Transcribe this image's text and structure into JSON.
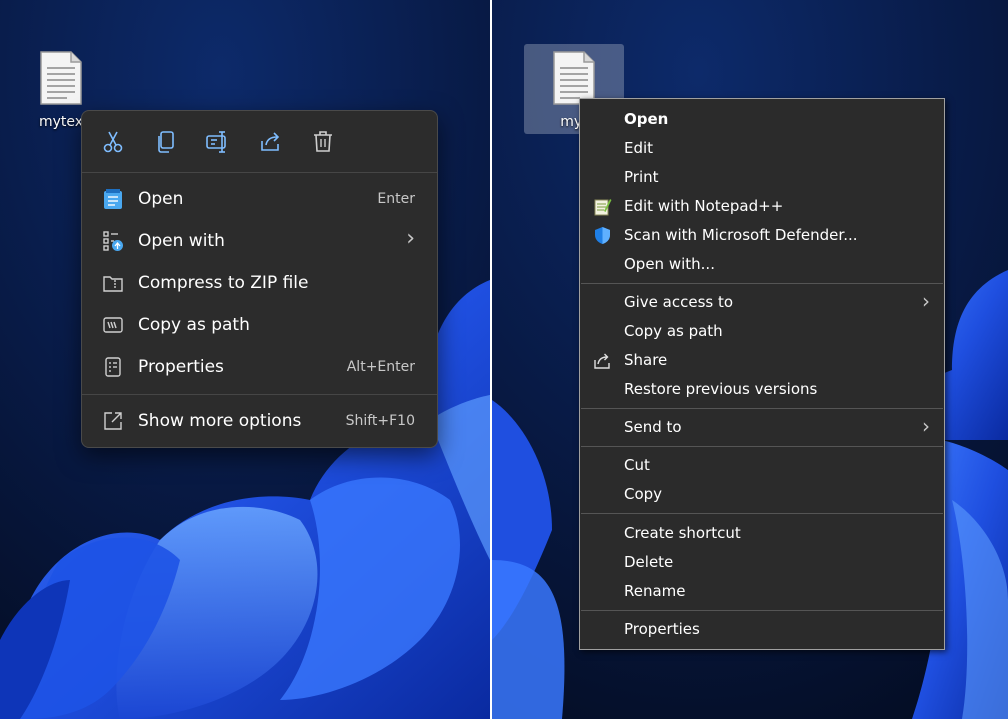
{
  "left_panel": {
    "file_label": "mytex",
    "toolbar": [
      {
        "icon": "cut-icon",
        "title": "Cut"
      },
      {
        "icon": "copy-icon",
        "title": "Copy"
      },
      {
        "icon": "rename-icon",
        "title": "Rename"
      },
      {
        "icon": "share-icon",
        "title": "Share"
      },
      {
        "icon": "delete-icon",
        "title": "Delete"
      }
    ],
    "items": [
      {
        "label": "Open",
        "shortcut": "Enter",
        "icon": "notepad-icon"
      },
      {
        "label": "Open with",
        "shortcut": "",
        "icon": "open-with-icon",
        "submenu": true
      },
      {
        "label": "Compress to ZIP file",
        "shortcut": "",
        "icon": "zip-folder-icon"
      },
      {
        "label": "Copy as path",
        "shortcut": "",
        "icon": "copy-path-icon"
      },
      {
        "label": "Properties",
        "shortcut": "Alt+Enter",
        "icon": "properties-icon"
      },
      {
        "label": "Show more options",
        "shortcut": "Shift+F10",
        "icon": "show-more-options-icon"
      }
    ]
  },
  "right_panel": {
    "file_label": "myt",
    "items": [
      {
        "label": "Open",
        "bold": true
      },
      {
        "label": "Edit"
      },
      {
        "label": "Print"
      },
      {
        "label": "Edit with Notepad++",
        "icon": "notepad-plus-plus-icon"
      },
      {
        "label": "Scan with Microsoft Defender...",
        "icon": "defender-shield-icon"
      },
      {
        "label": "Open with..."
      },
      {
        "label": "Give access to",
        "submenu": true
      },
      {
        "label": "Copy as path"
      },
      {
        "label": "Share",
        "icon": "share-icon"
      },
      {
        "label": "Restore previous versions"
      },
      {
        "label": "Send to",
        "submenu": true
      },
      {
        "label": "Cut"
      },
      {
        "label": "Copy"
      },
      {
        "label": "Create shortcut"
      },
      {
        "label": "Delete"
      },
      {
        "label": "Rename"
      },
      {
        "label": "Properties"
      }
    ]
  },
  "colors": {
    "menu_bg_modern": "#2c2c2c",
    "menu_bg_classic": "#2b2b2b",
    "icon_accent": "#60b4ff",
    "desktop_bg": "#06122e"
  }
}
